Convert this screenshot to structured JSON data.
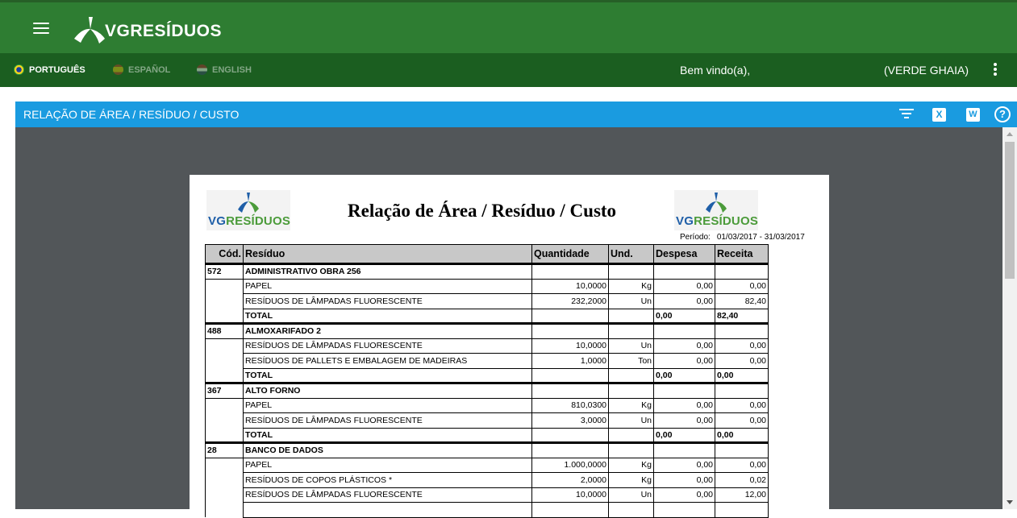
{
  "header": {
    "logo_text": "VGRESÍDUOS"
  },
  "subbar": {
    "languages": [
      "PORTUGUÊS",
      "ESPAÑOL",
      "ENGLISH"
    ],
    "welcome": "Bem vindo(a),",
    "username": "(VERDE GHAIA)"
  },
  "panel": {
    "title": "RELAÇÃO DE ÁREA / RESÍDUO / CUSTO",
    "excel_label": "X",
    "word_label": "W",
    "help_label": "?"
  },
  "report": {
    "logo_vg": "VG",
    "logo_res": "RESÍDUOS",
    "title": "Relação de Área / Resíduo / Custo",
    "period_label": "Período:",
    "period_value": "01/03/2017 - 31/03/2017",
    "columns": [
      "Cód.",
      "Resíduo",
      "Quantidade",
      "Und.",
      "Despesa",
      "Receita"
    ],
    "groups": [
      {
        "code": "572",
        "area": "ADMINISTRATIVO OBRA 256",
        "items": [
          {
            "residuo": "PAPEL",
            "quantidade": "10,0000",
            "und": "Kg",
            "despesa": "0,00",
            "receita": "0,00"
          },
          {
            "residuo": "RESÍDUOS DE LÂMPADAS FLUORESCENTE",
            "quantidade": "232,2000",
            "und": "Un",
            "despesa": "0,00",
            "receita": "82,40"
          }
        ],
        "total_label": "TOTAL",
        "total_despesa": "0,00",
        "total_receita": "82,40"
      },
      {
        "code": "488",
        "area": "ALMOXARIFADO 2",
        "items": [
          {
            "residuo": "RESÍDUOS DE LÂMPADAS FLUORESCENTE",
            "quantidade": "10,0000",
            "und": "Un",
            "despesa": "0,00",
            "receita": "0,00"
          },
          {
            "residuo": "RESÍDUOS DE PALLETS E EMBALAGEM DE MADEIRAS",
            "quantidade": "1,0000",
            "und": "Ton",
            "despesa": "0,00",
            "receita": "0,00"
          }
        ],
        "total_label": "TOTAL",
        "total_despesa": "0,00",
        "total_receita": "0,00"
      },
      {
        "code": "367",
        "area": "ALTO FORNO",
        "items": [
          {
            "residuo": "PAPEL",
            "quantidade": "810,0300",
            "und": "Kg",
            "despesa": "0,00",
            "receita": "0,00"
          },
          {
            "residuo": "RESÍDUOS DE LÂMPADAS FLUORESCENTE",
            "quantidade": "3,0000",
            "und": "Un",
            "despesa": "0,00",
            "receita": "0,00"
          }
        ],
        "total_label": "TOTAL",
        "total_despesa": "0,00",
        "total_receita": "0,00"
      },
      {
        "code": "28",
        "area": "BANCO DE DADOS",
        "items": [
          {
            "residuo": "PAPEL",
            "quantidade": "1.000,0000",
            "und": "Kg",
            "despesa": "0,00",
            "receita": "0,00"
          },
          {
            "residuo": "RESÍDUOS DE COPOS PLÁSTICOS *",
            "quantidade": "2,0000",
            "und": "Kg",
            "despesa": "0,00",
            "receita": "0,02"
          },
          {
            "residuo": "RESÍDUOS DE LÂMPADAS FLUORESCENTE",
            "quantidade": "10,0000",
            "und": "Un",
            "despesa": "0,00",
            "receita": "12,00"
          },
          {
            "residuo": "",
            "quantidade": "",
            "und": "",
            "despesa": "",
            "receita": ""
          }
        ]
      }
    ]
  }
}
